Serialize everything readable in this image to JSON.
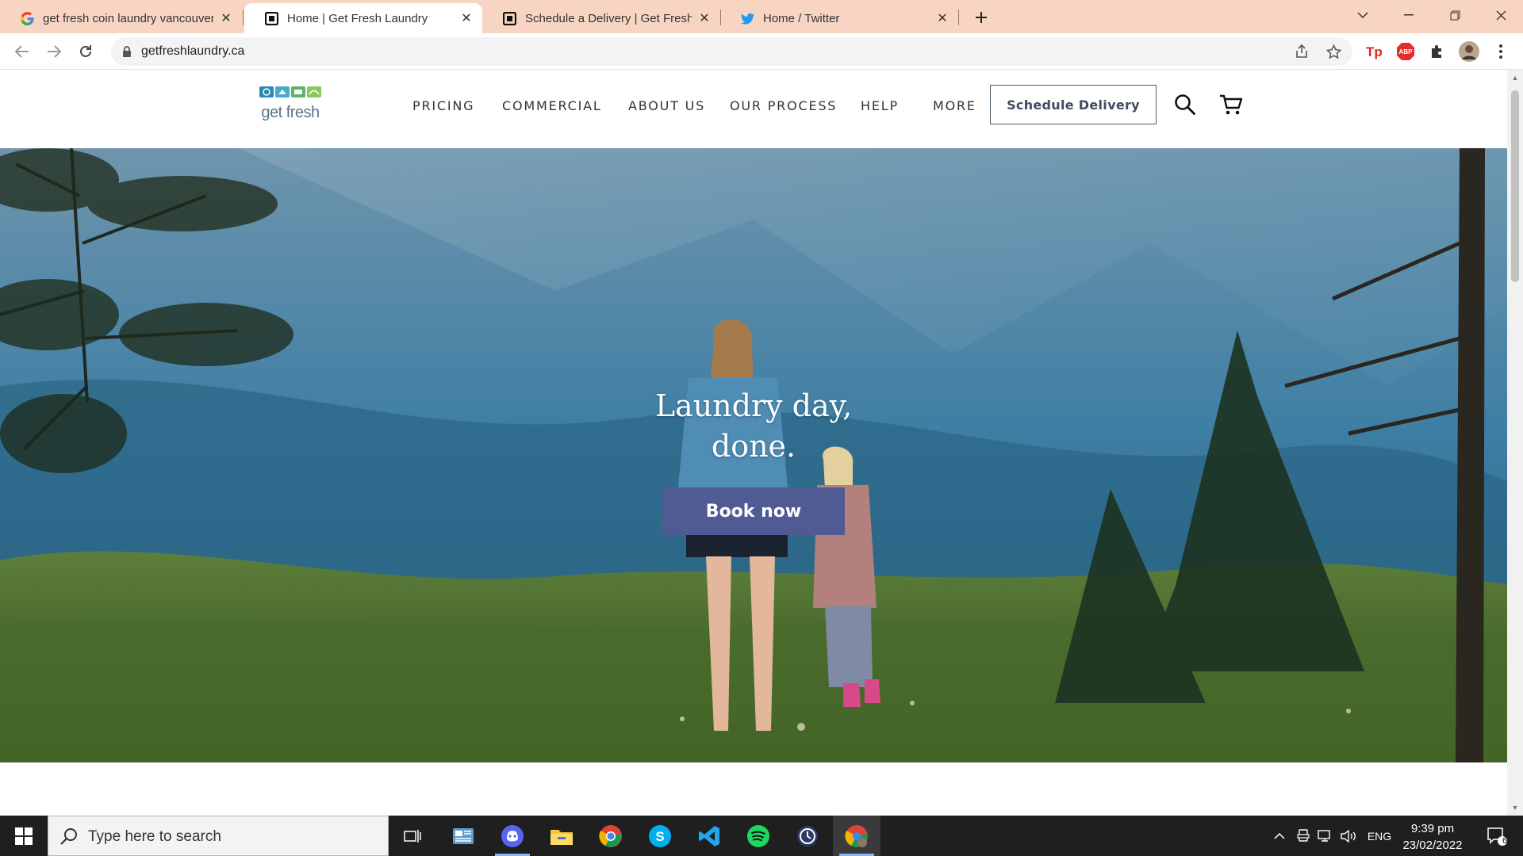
{
  "browser": {
    "tabs": [
      {
        "title": "get fresh coin laundry vancouver",
        "favicon": "google-g-icon"
      },
      {
        "title": "Home | Get Fresh Laundry",
        "favicon": "squarespace-icon"
      },
      {
        "title": "Schedule a Delivery | Get Fresh La",
        "favicon": "squarespace-icon"
      },
      {
        "title": "Home / Twitter",
        "favicon": "twitter-bird-icon"
      }
    ],
    "active_tab": 1,
    "url": "getfreshlaundry.ca"
  },
  "site": {
    "logo_text": "get fresh",
    "nav": [
      "PRICING",
      "COMMERCIAL",
      "ABOUT US",
      "OUR PROCESS",
      "HELP",
      "MORE"
    ],
    "schedule_label": "Schedule Delivery",
    "hero_title_line1": "Laundry day,",
    "hero_title_line2": "done.",
    "book_label": "Book now"
  },
  "taskbar": {
    "search_placeholder": "Type here to search",
    "language": "ENG",
    "time": "9:39 pm",
    "date": "23/02/2022",
    "notification_count": "6"
  },
  "colors": {
    "tab_strip": "#f8d5c2",
    "book_button": "#4f5b92",
    "schedule_border": "#4a5a6c"
  }
}
